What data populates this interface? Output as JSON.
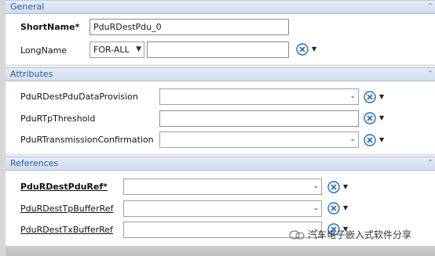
{
  "sections": {
    "general": {
      "title": "General",
      "shortname_label": "ShortName*",
      "shortname_value": "PduRDestPdu_0",
      "longname_label": "LongName",
      "longname_lang": "FOR-ALL",
      "longname_value": ""
    },
    "attributes": {
      "title": "Attributes",
      "rows": [
        {
          "label": "PduRDestPduDataProvision",
          "value": ""
        },
        {
          "label": "PduRTpThreshold",
          "value": ""
        },
        {
          "label": "PduRTransmissionConfirmation",
          "value": ""
        }
      ]
    },
    "references": {
      "title": "References",
      "rows": [
        {
          "label": "PduRDestPduRef*",
          "value": ""
        },
        {
          "label": "PduRDestTpBufferRef",
          "value": ""
        },
        {
          "label": "PduRDestTxBufferRef",
          "value": ""
        }
      ]
    }
  },
  "watermark": {
    "text": "汽车电子嵌入式软件分享"
  },
  "colors": {
    "header_text": "#2a5caa",
    "tool_icon": "#1f6fc0"
  },
  "icons": {
    "collapse": "collapse-icon",
    "tool": "tool-wrench-icon",
    "menu": "dropdown-arrow-icon",
    "watermark": "wechat-icon"
  }
}
